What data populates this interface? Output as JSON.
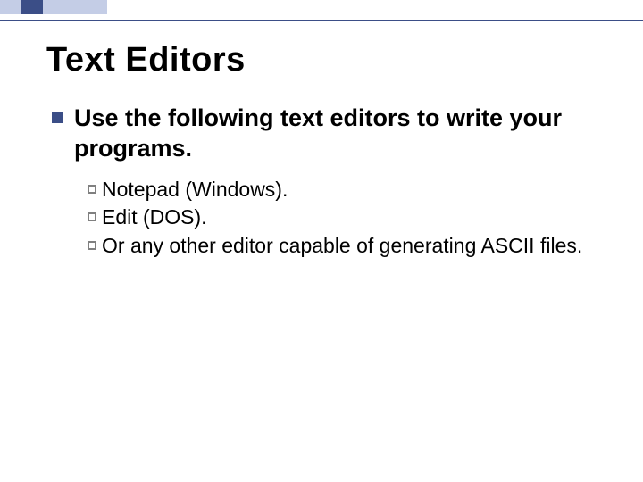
{
  "title": "Text Editors",
  "main_point": "Use the following text editors to write your programs.",
  "sub_points": {
    "0": "Notepad (Windows).",
    "1": "Edit (DOS).",
    "2": "Or any other editor capable of generating ASCII files."
  }
}
